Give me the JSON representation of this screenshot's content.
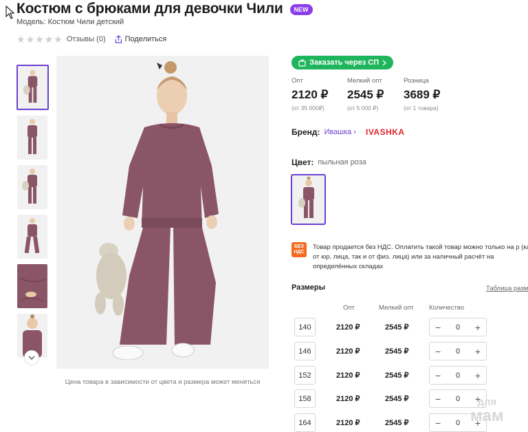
{
  "product": {
    "title": "Костюм с брюками для девочки Чили",
    "badge": "NEW",
    "model": "Модель: Костюм Чили детский"
  },
  "rating": {
    "stars_filled": 0,
    "stars_total": 5,
    "reviews": "Отзывы (0)",
    "share": "Поделиться"
  },
  "gallery": {
    "thumbnails_count": 6,
    "selected_index": 0,
    "note": "Цена товара в зависимости от цвета и размера может меняться"
  },
  "order_button": "Заказать через СП",
  "prices": [
    {
      "label": "Опт",
      "value": "2120 ₽",
      "note": "(от 35 000₽)"
    },
    {
      "label": "Мелкий опт",
      "value": "2545 ₽",
      "note": "(от 5 000 ₽)"
    },
    {
      "label": "Розница",
      "value": "3689 ₽",
      "note": "(от 1 товара)"
    }
  ],
  "brand": {
    "label": "Бренд:",
    "name": "Ивашка",
    "logo_text": "IVASHKA"
  },
  "color": {
    "label": "Цвет:",
    "value": "пыльная роза"
  },
  "vat": {
    "icon_line1": "БЕЗ",
    "icon_line2": "НДС",
    "text": "Товар продается без НДС. Оплатить такой товар можно только на р (как от юр. лица, так и от физ. лица) или за наличный расчёт на определённых складах"
  },
  "sizes": {
    "title": "Размеры",
    "table_link": "Таблица разме",
    "headers": {
      "opt": "Опт",
      "small_opt": "Мелкий опт",
      "qty": "Количество"
    },
    "rows": [
      {
        "size": "140",
        "opt": "2120 ₽",
        "small_opt": "2545 ₽",
        "qty": "0"
      },
      {
        "size": "146",
        "opt": "2120 ₽",
        "small_opt": "2545 ₽",
        "qty": "0"
      },
      {
        "size": "152",
        "opt": "2120 ₽",
        "small_opt": "2545 ₽",
        "qty": "0"
      },
      {
        "size": "158",
        "opt": "2120 ₽",
        "small_opt": "2545 ₽",
        "qty": "0"
      },
      {
        "size": "164",
        "opt": "2120 ₽",
        "small_opt": "2545 ₽",
        "qty": "0"
      }
    ]
  },
  "watermark": {
    "line1": "для",
    "line2": "мам"
  },
  "colors": {
    "accent": "#6b3fd0",
    "green": "#1fb55c",
    "suit": "#8a5566",
    "brand_red": "#e2232c"
  }
}
